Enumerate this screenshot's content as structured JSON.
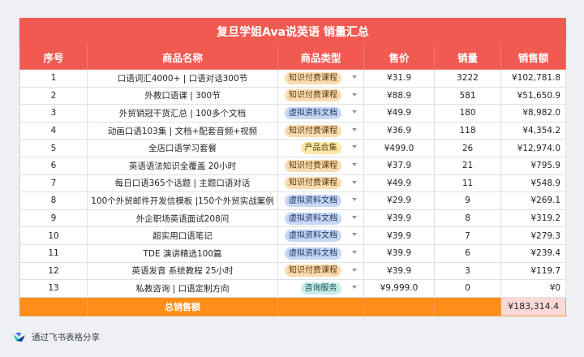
{
  "title": "复旦学姐Ava说英语 销量汇总",
  "headers": [
    "序号",
    "商品名称",
    "商品类型",
    "售价",
    "销量",
    "销售额"
  ],
  "rows": [
    {
      "no": "1",
      "name": "口语词汇4000+ | 口语对话300节",
      "type": "知识付费课程",
      "tag": "orange",
      "price": "¥31.9",
      "qty": "3222",
      "revenue": "¥102,781.8"
    },
    {
      "no": "2",
      "name": "外教口语课 | 300节",
      "type": "知识付费课程",
      "tag": "orange",
      "price": "¥88.9",
      "qty": "581",
      "revenue": "¥51,650.9"
    },
    {
      "no": "3",
      "name": "外贸销冠干货汇总 | 100多个文档",
      "type": "虚拟资料文档",
      "tag": "blue",
      "price": "¥49.9",
      "qty": "180",
      "revenue": "¥8,982.0"
    },
    {
      "no": "4",
      "name": "动画口语103集 | 文档+配套音频+视频",
      "type": "知识付费课程",
      "tag": "orange",
      "price": "¥36.9",
      "qty": "118",
      "revenue": "¥4,354.2"
    },
    {
      "no": "5",
      "name": "全店口语学习套餐",
      "type": "产品合集",
      "tag": "yellow",
      "price": "¥499.0",
      "qty": "26",
      "revenue": "¥12,974.0"
    },
    {
      "no": "6",
      "name": "英语语法知识全覆盖 20小时",
      "type": "知识付费课程",
      "tag": "orange",
      "price": "¥37.9",
      "qty": "21",
      "revenue": "¥795.9"
    },
    {
      "no": "7",
      "name": "每日口语365个话题 | 主题口语对话",
      "type": "知识付费课程",
      "tag": "orange",
      "price": "¥49.9",
      "qty": "11",
      "revenue": "¥548.9"
    },
    {
      "no": "8",
      "name": "100个外贸邮件开发信模板 |150个外贸实战案例",
      "type": "虚拟资料文档",
      "tag": "blue",
      "price": "¥29.9",
      "qty": "9",
      "revenue": "¥269.1"
    },
    {
      "no": "9",
      "name": "外企职场英语面试208问",
      "type": "虚拟资料文档",
      "tag": "blue",
      "price": "¥39.9",
      "qty": "8",
      "revenue": "¥319.2"
    },
    {
      "no": "10",
      "name": "超实用口语笔记",
      "type": "虚拟资料文档",
      "tag": "blue",
      "price": "¥39.9",
      "qty": "7",
      "revenue": "¥279.3"
    },
    {
      "no": "11",
      "name": "TDE 演讲精选100篇",
      "type": "虚拟资料文档",
      "tag": "blue",
      "price": "¥39.9",
      "qty": "6",
      "revenue": "¥239.4"
    },
    {
      "no": "12",
      "name": "英语发音 系统教程 25小时",
      "type": "知识付费课程",
      "tag": "orange",
      "price": "¥39.9",
      "qty": "3",
      "revenue": "¥119.7"
    },
    {
      "no": "13",
      "name": "私教咨询 | 口语定制方向",
      "type": "咨询服务",
      "tag": "green",
      "price": "¥9,999.0",
      "qty": "0",
      "revenue": "¥0"
    }
  ],
  "total": {
    "label": "总销售额",
    "value": "¥183,314.4"
  },
  "footer": {
    "text": "通过飞书表格分享",
    "icon": "feishu-logo-icon"
  },
  "colors": {
    "header": "#f15a50",
    "total_row": "#ff8d1a",
    "total_value_bg": "#fcd9d6"
  }
}
